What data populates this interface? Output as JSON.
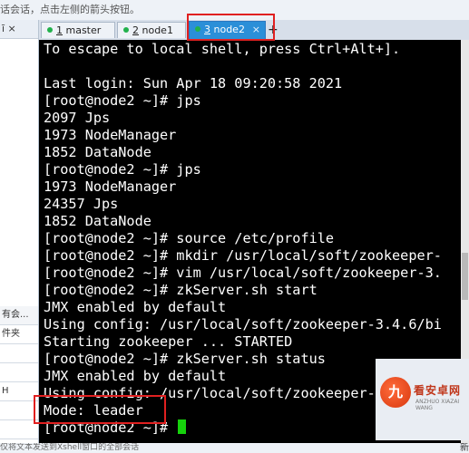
{
  "hint": "话会话，点击左侧的箭头按钮。",
  "sidebar": {
    "head": "ī ×",
    "items": [
      "有会...",
      "件夹",
      "",
      "",
      "H",
      "",
      ""
    ]
  },
  "tabs": [
    {
      "number": "1",
      "name": "master",
      "active": false
    },
    {
      "number": "2",
      "name": "node1",
      "active": false
    },
    {
      "number": "3",
      "name": "node2",
      "active": true
    }
  ],
  "tab_add": "+",
  "terminal": {
    "lines": [
      "To escape to local shell, press Ctrl+Alt+].",
      "",
      "Last login: Sun Apr 18 09:20:58 2021",
      "[root@node2 ~]# jps",
      "2097 Jps",
      "1973 NodeManager",
      "1852 DataNode",
      "[root@node2 ~]# jps",
      "1973 NodeManager",
      "24357 Jps",
      "1852 DataNode",
      "[root@node2 ~]# source /etc/profile",
      "[root@node2 ~]# mkdir /usr/local/soft/zookeeper-",
      "[root@node2 ~]# vim /usr/local/soft/zookeeper-3.",
      "[root@node2 ~]# zkServer.sh start",
      "JMX enabled by default",
      "Using config: /usr/local/soft/zookeeper-3.4.6/bi",
      "Starting zookeeper ... STARTED",
      "[root@node2 ~]# zkServer.sh status",
      "JMX enabled by default",
      "Using config: /usr/local/soft/zookeeper-3.4.6/bi",
      "Mode: leader",
      "[root@node2 ~]# "
    ]
  },
  "watermark": {
    "logo": "九",
    "text": "看安卓网",
    "sub": "ANZHUO XIAZAI WANG"
  },
  "status": {
    "left": "仅将文本发送到Xshell窗口的全部会话",
    "right": "新"
  },
  "colors": {
    "terminal_bg": "#000000",
    "terminal_fg": "#ffffff",
    "cursor": "#16d20c",
    "highlight": "#e02020",
    "active_tab": "#2b8fd8"
  }
}
